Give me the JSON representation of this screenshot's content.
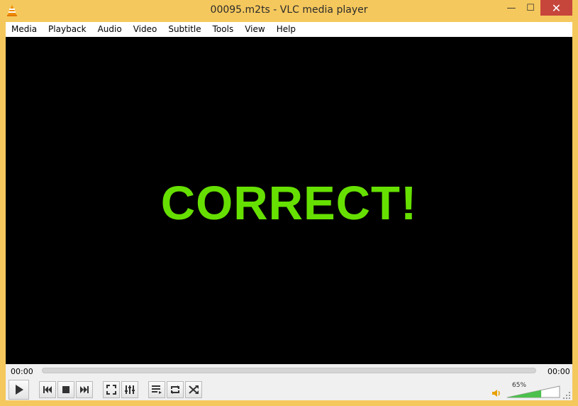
{
  "window": {
    "title": "00095.m2ts - VLC media player"
  },
  "menu": [
    "Media",
    "Playback",
    "Audio",
    "Video",
    "Subtitle",
    "Tools",
    "View",
    "Help"
  ],
  "video": {
    "overlay_text": "CORRECT!",
    "overlay_color": "#66e000"
  },
  "playback": {
    "elapsed": "00:00",
    "total": "00:00",
    "position_fraction": 0
  },
  "volume": {
    "label": "65%",
    "level_fraction": 0.65
  },
  "controls": [
    "play-icon",
    "previous-icon",
    "stop-icon",
    "next-icon",
    "fullscreen-icon",
    "extended-settings-icon",
    "playlist-icon",
    "loop-icon",
    "shuffle-icon"
  ],
  "colors": {
    "frame": "#f5c85d",
    "close": "#c7463b",
    "volume_fill": "#4cc04c"
  }
}
